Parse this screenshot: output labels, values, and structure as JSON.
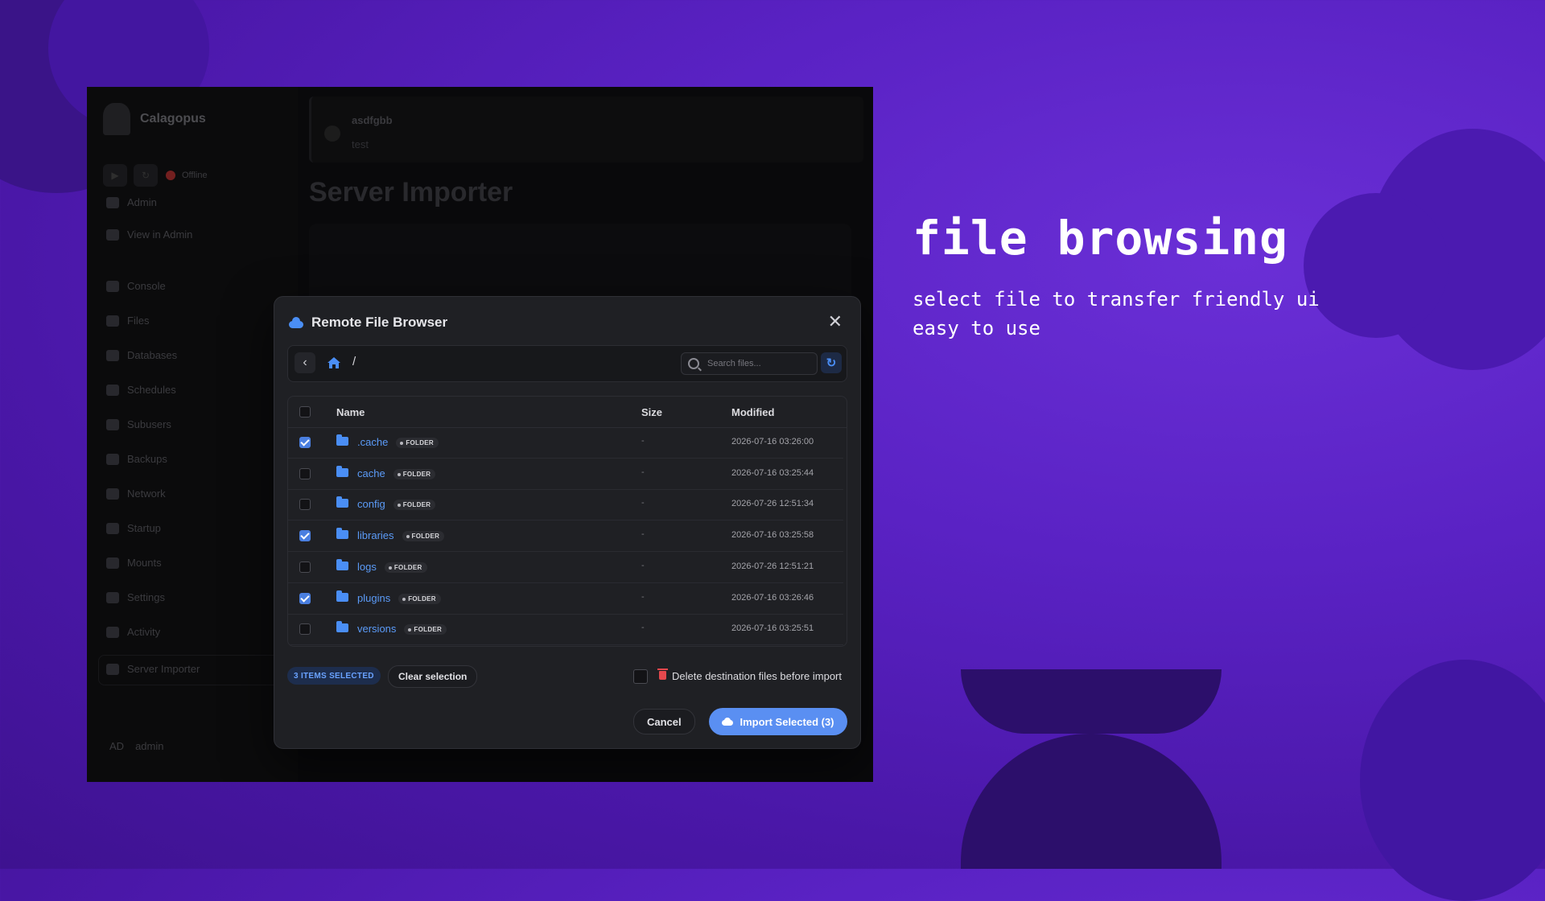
{
  "marketing": {
    "headline": "file browsing",
    "sub_line_1": "select file to transfer friendly ui",
    "sub_line_2": "easy to use"
  },
  "app": {
    "brand": "Calagopus",
    "status": "Offline",
    "notice_title": "asdfgbb",
    "notice_body": "test",
    "page_title": "Server Importer",
    "sidebar": [
      {
        "label": "Admin",
        "icon": "shield-icon"
      },
      {
        "label": "View in Admin",
        "icon": "external-link-icon"
      },
      {
        "label": "Console",
        "icon": "terminal-icon"
      },
      {
        "label": "Files",
        "icon": "folder-icon"
      },
      {
        "label": "Databases",
        "icon": "database-icon"
      },
      {
        "label": "Schedules",
        "icon": "clock-icon"
      },
      {
        "label": "Subusers",
        "icon": "users-icon"
      },
      {
        "label": "Backups",
        "icon": "archive-icon"
      },
      {
        "label": "Network",
        "icon": "network-icon"
      },
      {
        "label": "Startup",
        "icon": "play-icon"
      },
      {
        "label": "Mounts",
        "icon": "mount-icon"
      },
      {
        "label": "Settings",
        "icon": "gear-icon"
      },
      {
        "label": "Activity",
        "icon": "activity-icon"
      },
      {
        "label": "Server Importer",
        "icon": "cloud-icon"
      }
    ],
    "user_initials": "AD",
    "user_name": "admin"
  },
  "modal": {
    "title": "Remote File Browser",
    "path": "/",
    "search_placeholder": "Search files...",
    "columns": {
      "name": "Name",
      "size": "Size",
      "modified": "Modified"
    },
    "files": [
      {
        "name": ".cache",
        "type": "FOLDER",
        "size": "-",
        "modified": "2026-07-16 03:26:00",
        "checked": true
      },
      {
        "name": "cache",
        "type": "FOLDER",
        "size": "-",
        "modified": "2026-07-16 03:25:44",
        "checked": false
      },
      {
        "name": "config",
        "type": "FOLDER",
        "size": "-",
        "modified": "2026-07-26 12:51:34",
        "checked": false
      },
      {
        "name": "libraries",
        "type": "FOLDER",
        "size": "-",
        "modified": "2026-07-16 03:25:58",
        "checked": true
      },
      {
        "name": "logs",
        "type": "FOLDER",
        "size": "-",
        "modified": "2026-07-26 12:51:21",
        "checked": false
      },
      {
        "name": "plugins",
        "type": "FOLDER",
        "size": "-",
        "modified": "2026-07-16 03:26:46",
        "checked": true
      },
      {
        "name": "versions",
        "type": "FOLDER",
        "size": "-",
        "modified": "2026-07-16 03:25:51",
        "checked": false
      }
    ],
    "selected_count_label": "3 ITEMS SELECTED",
    "clear_selection": "Clear selection",
    "delete_dest_label": "Delete destination files before import",
    "cancel": "Cancel",
    "import": "Import Selected (3)"
  },
  "colors": {
    "accent": "#5a8ff2",
    "danger": "#e5484d",
    "background": "#5a22c4"
  }
}
